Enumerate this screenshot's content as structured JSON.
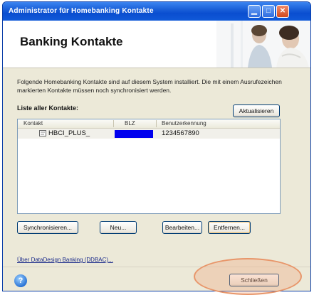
{
  "window": {
    "title": "Administrator für Homebanking Kontakte"
  },
  "titlebar_buttons": {
    "minimize": "▁",
    "maximize": "□",
    "close": "✕"
  },
  "header": {
    "title": "Banking Kontakte"
  },
  "intro_text": "Folgende Homebanking Kontakte sind auf diesem System installiert. Die mit einem Ausrufezeichen markierten Kontakte müssen noch synchronisiert werden.",
  "list": {
    "label": "Liste aller Kontakte:",
    "refresh_label": "Aktualisieren",
    "columns": [
      "Kontakt",
      "BLZ",
      "Benutzerkennung"
    ],
    "rows": [
      {
        "kontakt": "HBCI_PLUS_",
        "blz": "",
        "benutzerkennung": "1234567890"
      }
    ]
  },
  "buttons": {
    "sync": "Synchronisieren...",
    "new": "Neu...",
    "edit": "Bearbeiten...",
    "remove": "Entfernen..."
  },
  "about_link": "Über DataDesign Banking (DDBAC)...",
  "footer": {
    "help": "?",
    "close_label": "Schließen"
  },
  "colors": {
    "titlebar": "#0a4ed0",
    "blz_redaction": "#0000ee",
    "highlight": "#e8966a"
  }
}
